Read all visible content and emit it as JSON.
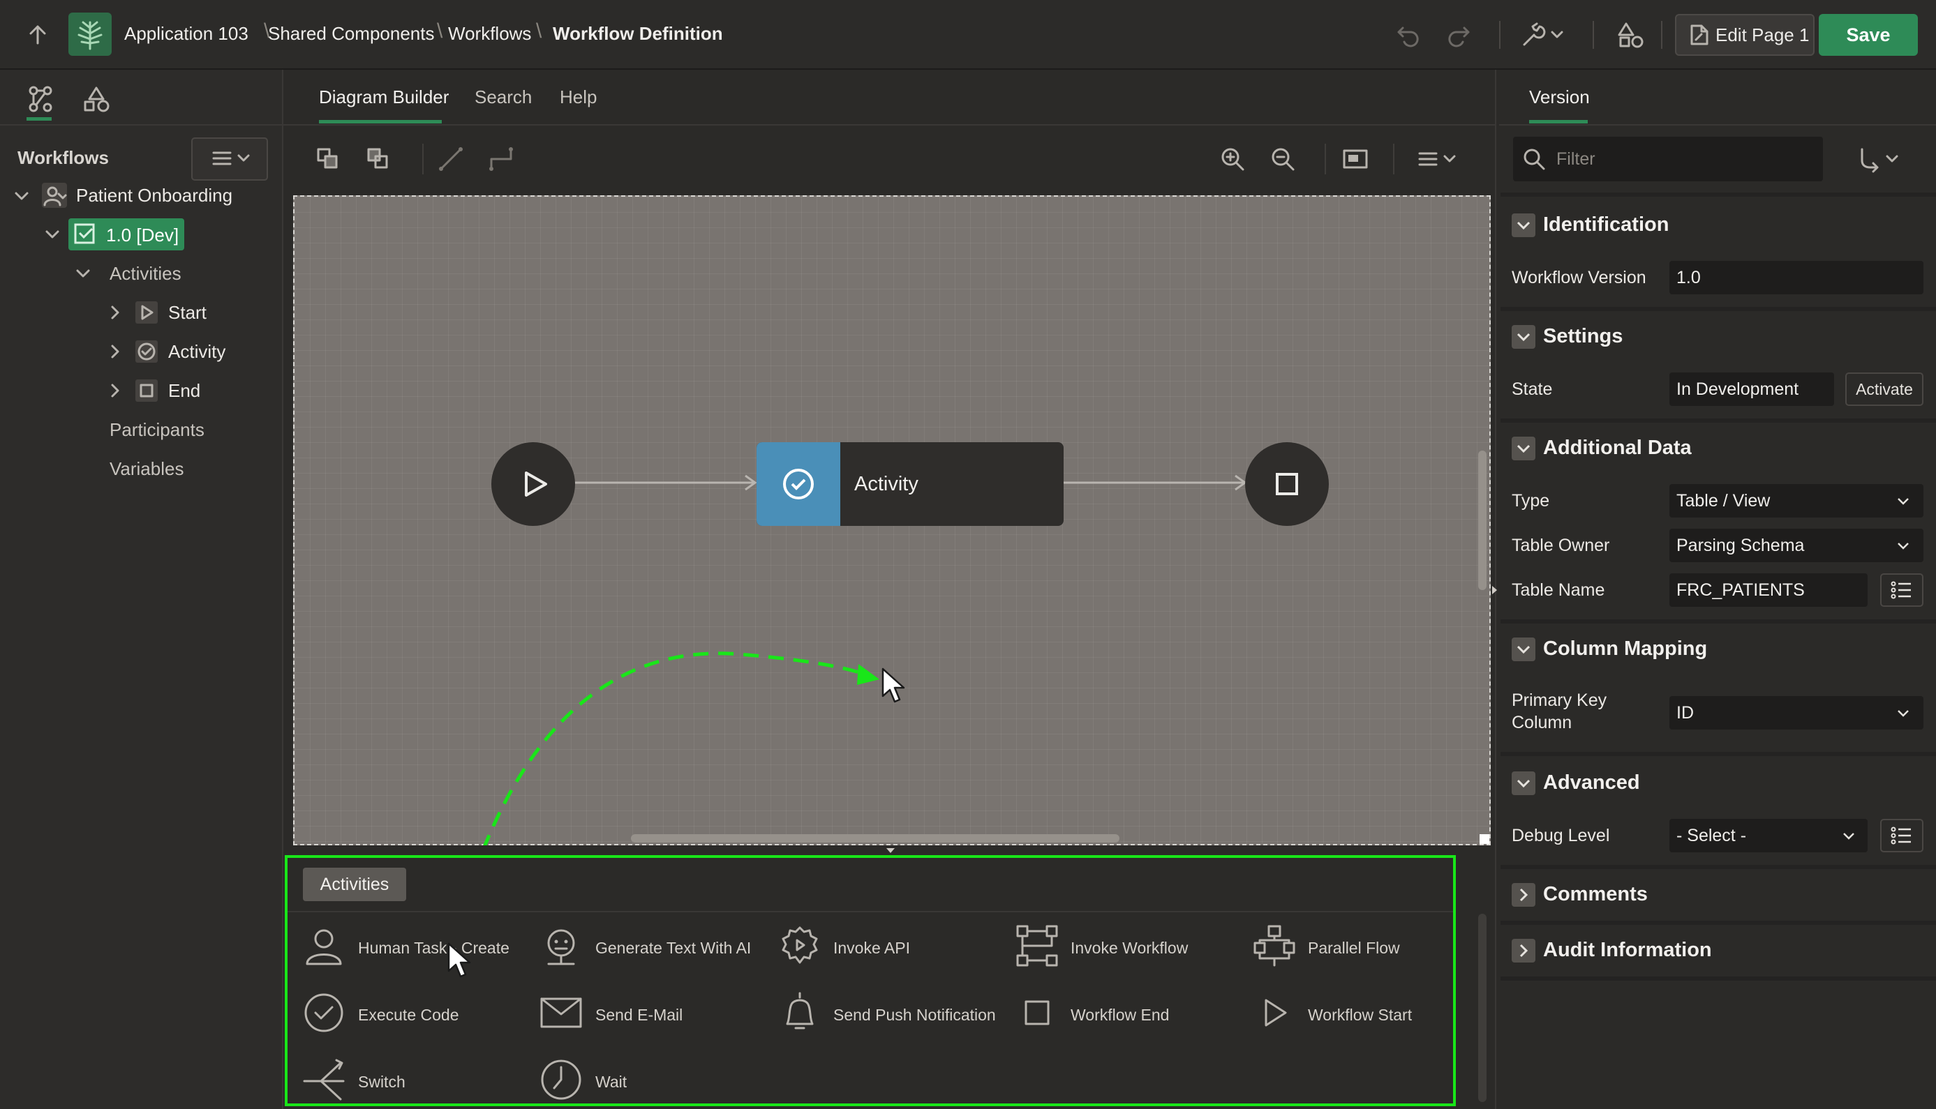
{
  "breadcrumb": {
    "items": [
      "Application 103",
      "Shared Components",
      "Workflows",
      "Workflow Definition"
    ]
  },
  "toolbar": {
    "edit_page_label": "Edit Page 1",
    "save_label": "Save"
  },
  "left_panel": {
    "section_title": "Workflows",
    "tree": {
      "root": "Patient Onboarding",
      "version": "1.0 [Dev]",
      "activities_label": "Activities",
      "activities": [
        "Start",
        "Activity",
        "End"
      ],
      "participants": "Participants",
      "variables": "Variables"
    }
  },
  "center": {
    "tabs": [
      "Diagram Builder",
      "Search",
      "Help"
    ],
    "diagram": {
      "activity_label": "Activity"
    },
    "palette": {
      "tab_label": "Activities",
      "items": [
        {
          "label": "Human Task - Create",
          "icon": "person-icon"
        },
        {
          "label": "Generate Text With AI",
          "icon": "ai-icon"
        },
        {
          "label": "Invoke API",
          "icon": "gear-icon"
        },
        {
          "label": "Invoke Workflow",
          "icon": "workflow-icon"
        },
        {
          "label": "Parallel Flow",
          "icon": "parallel-icon"
        },
        {
          "label": "Execute Code",
          "icon": "check-circle-icon"
        },
        {
          "label": "Send E-Mail",
          "icon": "mail-icon"
        },
        {
          "label": "Send Push Notification",
          "icon": "bell-icon"
        },
        {
          "label": "Workflow End",
          "icon": "square-icon"
        },
        {
          "label": "Workflow Start",
          "icon": "play-icon"
        },
        {
          "label": "Switch",
          "icon": "switch-icon"
        },
        {
          "label": "Wait",
          "icon": "clock-icon"
        }
      ]
    }
  },
  "right_panel": {
    "tab": "Version",
    "filter_placeholder": "Filter",
    "sections": {
      "identification": {
        "title": "Identification",
        "workflow_version_label": "Workflow Version",
        "workflow_version_value": "1.0"
      },
      "settings": {
        "title": "Settings",
        "state_label": "State",
        "state_value": "In Development",
        "activate_label": "Activate"
      },
      "additional_data": {
        "title": "Additional Data",
        "type_label": "Type",
        "type_value": "Table / View",
        "table_owner_label": "Table Owner",
        "table_owner_value": "Parsing Schema",
        "table_name_label": "Table Name",
        "table_name_value": "FRC_PATIENTS"
      },
      "column_mapping": {
        "title": "Column Mapping",
        "pk_label_line1": "Primary Key",
        "pk_label_line2": "Column",
        "pk_value": "ID"
      },
      "advanced": {
        "title": "Advanced",
        "debug_label": "Debug Level",
        "debug_value": "- Select -"
      },
      "comments": {
        "title": "Comments"
      },
      "audit": {
        "title": "Audit Information"
      }
    }
  },
  "colors": {
    "accent_green": "#2e8b57",
    "highlight_green": "#19e619",
    "activity_blue": "#4a8fb8"
  }
}
